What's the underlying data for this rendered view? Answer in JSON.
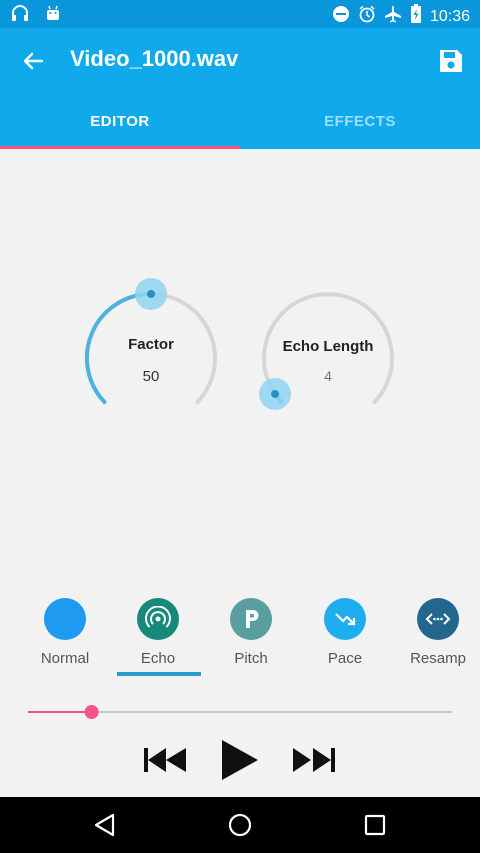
{
  "status_bar": {
    "time": "10:36",
    "left_icons": [
      "headphones-icon",
      "android-icon"
    ],
    "right_icons": [
      "do-not-disturb-icon",
      "alarm-icon",
      "airplane-icon",
      "battery-charging-icon"
    ]
  },
  "app_bar": {
    "title": "Video_1000.wav",
    "back_icon": "arrow-back-icon",
    "save_icon": "save-icon"
  },
  "tabs": [
    {
      "label": "EDITOR",
      "selected": true
    },
    {
      "label": "EFFECTS",
      "selected": false
    }
  ],
  "knobs": [
    {
      "label": "Factor",
      "value": "50",
      "level": 0.5
    },
    {
      "label": "Echo Length",
      "value": "4",
      "level": 0.04
    }
  ],
  "effects": [
    {
      "label": "Normal",
      "color": "#1e9af0",
      "icon": "none",
      "selected": false
    },
    {
      "label": "Echo",
      "color": "#17897a",
      "icon": "echo-icon",
      "selected": true
    },
    {
      "label": "Pitch",
      "color": "#5a9ea0",
      "icon": "pitch-p-icon",
      "selected": false
    },
    {
      "label": "Pace",
      "color": "#1eaef0",
      "icon": "pace-icon",
      "selected": false
    },
    {
      "label": "Resamp",
      "color": "#23678f",
      "icon": "resample-icon",
      "selected": false
    }
  ],
  "seekbar": {
    "progress": 0.15
  },
  "playback": {
    "controls": [
      "skip-previous-icon",
      "play-icon",
      "skip-next-icon"
    ]
  },
  "nav_bar": {
    "buttons": [
      "back-triangle-icon",
      "home-circle-icon",
      "recents-square-icon"
    ]
  },
  "colors": {
    "accent": "#10a9ec",
    "status_bar": "#0a96da",
    "tab_indicator": "#ff4f7b",
    "knob_active": "#4bb3de",
    "seek_active": "#f4538a"
  }
}
